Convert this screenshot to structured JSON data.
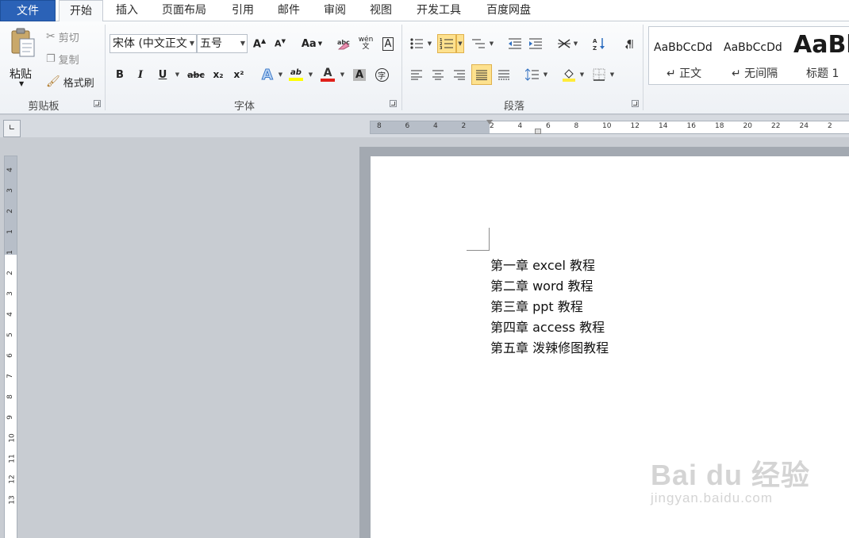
{
  "tabs": [
    {
      "label": "文件"
    },
    {
      "label": "开始"
    },
    {
      "label": "插入"
    },
    {
      "label": "页面布局"
    },
    {
      "label": "引用"
    },
    {
      "label": "邮件"
    },
    {
      "label": "审阅"
    },
    {
      "label": "视图"
    },
    {
      "label": "开发工具"
    },
    {
      "label": "百度网盘"
    }
  ],
  "clipboard": {
    "paste": "粘贴",
    "cut": "剪切",
    "copy": "复制",
    "format_painter": "格式刷",
    "group_label": "剪贴板"
  },
  "font": {
    "font_name": "宋体 (中文正文",
    "font_size": "五号",
    "group_label": "字体",
    "case_label": "Aa",
    "phonetic_label": "wén",
    "char_border_label": "A",
    "bold": "B",
    "italic": "I",
    "underline": "U",
    "strike": "abc",
    "subscript": "x₂",
    "superscript": "x²",
    "effects": "A",
    "highlight": "ab",
    "font_color": "A",
    "char_shading": "A",
    "enclosed": "字"
  },
  "paragraph": {
    "group_label": "段落"
  },
  "styles": [
    {
      "preview": "AaBbCcDd",
      "name": "↵ 正文"
    },
    {
      "preview": "AaBbCcDd",
      "name": "↵ 无间隔"
    },
    {
      "preview": "AaBb",
      "name": "标题 1"
    }
  ],
  "ruler": {
    "h_marks": [
      "8",
      "6",
      "4",
      "2",
      "2",
      "4",
      "6",
      "8",
      "10",
      "12",
      "14",
      "16",
      "18",
      "20",
      "22",
      "24",
      "2"
    ],
    "v_marks": [
      "4",
      "3",
      "2",
      "1",
      "1",
      "2",
      "3",
      "4",
      "5",
      "6",
      "7",
      "8",
      "9",
      "10",
      "11",
      "12",
      "13"
    ]
  },
  "document": {
    "lines": [
      "第一章  excel 教程",
      "第二章  word 教程",
      "第三章  ppt 教程",
      "第四章  access 教程",
      "第五章  泼辣修图教程"
    ]
  },
  "watermark": {
    "brand": "Bai du 经验",
    "url": "jingyan.baidu.com"
  },
  "colors": {
    "file_tab": "#2b62b7",
    "highlight": "#fde18e",
    "font_red": "#e0201a",
    "highlight_yellow": "#ffff00"
  }
}
